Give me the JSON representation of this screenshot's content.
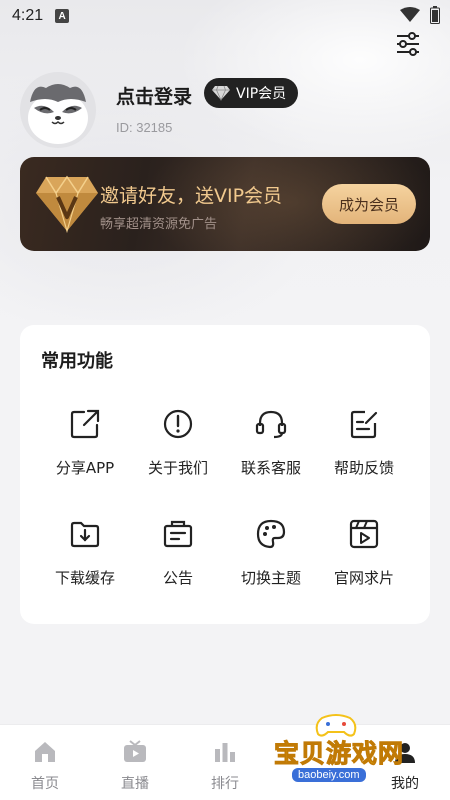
{
  "status_bar": {
    "time": "4:21",
    "notif_letter": "A"
  },
  "profile": {
    "login_text": "点击登录",
    "vip_badge": "VIP会员",
    "user_id": "ID: 32185"
  },
  "vip_card": {
    "title": "邀请好友，送VIP会员",
    "subtitle": "畅享超清资源免广告",
    "button": "成为会员"
  },
  "functions": {
    "title": "常用功能",
    "items": [
      {
        "label": "分享APP",
        "icon": "share-icon"
      },
      {
        "label": "关于我们",
        "icon": "info-icon"
      },
      {
        "label": "联系客服",
        "icon": "headset-icon"
      },
      {
        "label": "帮助反馈",
        "icon": "feedback-icon"
      },
      {
        "label": "下载缓存",
        "icon": "download-folder-icon"
      },
      {
        "label": "公告",
        "icon": "announcement-icon"
      },
      {
        "label": "切换主题",
        "icon": "palette-icon"
      },
      {
        "label": "官网求片",
        "icon": "film-request-icon"
      }
    ]
  },
  "tabbar": {
    "items": [
      {
        "label": "首页",
        "icon": "home-icon"
      },
      {
        "label": "直播",
        "icon": "tv-icon"
      },
      {
        "label": "排行",
        "icon": "ranking-icon"
      },
      {
        "label": "",
        "icon": ""
      },
      {
        "label": "我的",
        "icon": "profile-icon"
      }
    ]
  },
  "watermark": {
    "text": "宝贝游戏网",
    "url": "baobeiy.com"
  },
  "colors": {
    "accent_gold": "#f1c98e",
    "vip_card_bg": "#2a211d",
    "page_bg": "#f3f3f5"
  }
}
